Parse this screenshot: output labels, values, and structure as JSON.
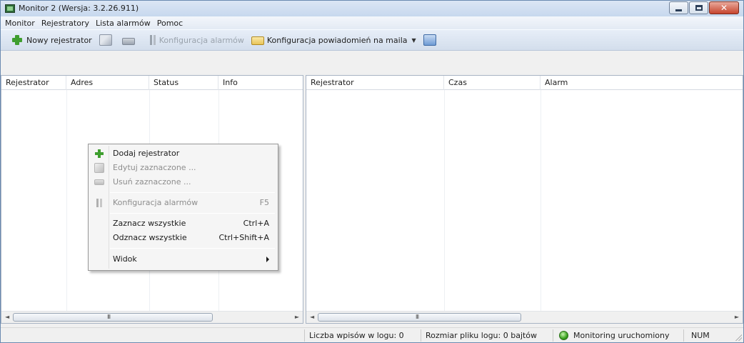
{
  "window": {
    "title": "Monitor 2 (Wersja: 3.2.26.911)"
  },
  "menubar": {
    "items": [
      "Monitor",
      "Rejestratory",
      "Lista alarmów",
      "Pomoc"
    ]
  },
  "toolbar": {
    "new_recorder_label": "Nowy rejestrator",
    "alarm_config_label": "Konfiguracja alarmów",
    "email_config_label": "Konfiguracja powiadomień na maila"
  },
  "left_list": {
    "columns": [
      "Rejestrator",
      "Adres",
      "Status",
      "Info"
    ]
  },
  "right_list": {
    "columns": [
      "Rejestrator",
      "Czas",
      "Alarm"
    ]
  },
  "context_menu": {
    "items": [
      {
        "label": "Dodaj rejestrator",
        "shortcut": "",
        "enabled": true
      },
      {
        "label": "Edytuj zaznaczone ...",
        "shortcut": "",
        "enabled": false
      },
      {
        "label": "Usuń zaznaczone ...",
        "shortcut": "",
        "enabled": false
      },
      {
        "label": "Konfiguracja alarmów",
        "shortcut": "F5",
        "enabled": false
      },
      {
        "label": "Zaznacz wszystkie",
        "shortcut": "Ctrl+A",
        "enabled": true
      },
      {
        "label": "Odznacz wszystkie",
        "shortcut": "Ctrl+Shift+A",
        "enabled": true
      },
      {
        "label": "Widok",
        "shortcut": "",
        "enabled": true
      }
    ]
  },
  "statusbar": {
    "log_entries": "Liczba wpisów w logu: 0",
    "log_size": "Rozmiar pliku logu: 0 bajtów",
    "monitoring": "Monitoring uruchomiony",
    "num": "NUM"
  },
  "scrollbar": {
    "grip": "III"
  },
  "colors": {
    "status_led": "#3aa11f",
    "plus_icon": "#3f9e2f"
  }
}
